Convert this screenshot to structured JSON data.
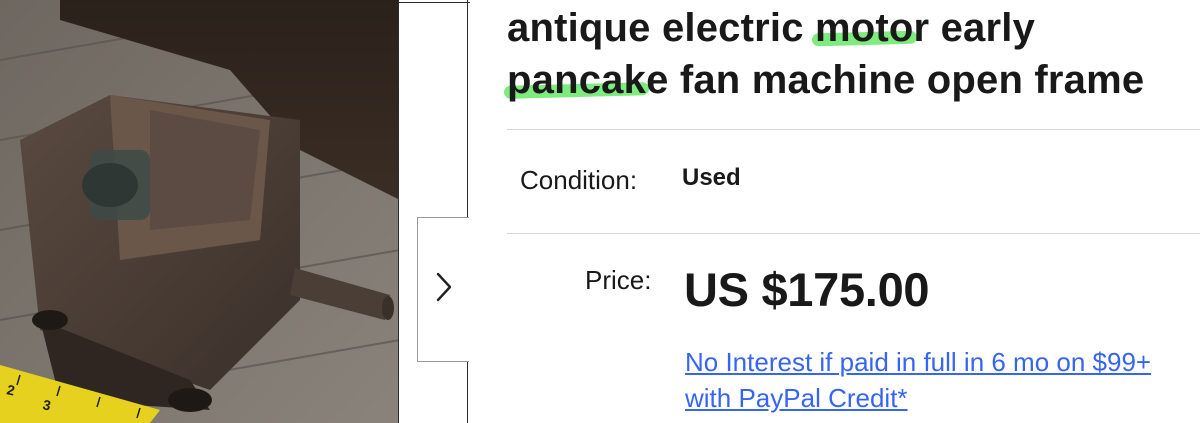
{
  "listing": {
    "title_line1_before": "antique electric ",
    "title_line1_highlight": "moto",
    "title_line1_after": "r early",
    "title_line2_highlight": "pancak",
    "title_line2_after": "e fan machine open frame",
    "condition_label": "Condition:",
    "condition_value": "Used",
    "price_label": "Price:",
    "price_value": "US $175.00",
    "credit_line1": "No Interest if paid in full in 6 mo on $99+",
    "credit_line2": "with PayPal Credit*"
  },
  "gallery": {
    "next_icon": "chevron-right-icon",
    "photo_subject": "rusty cast-iron electric motor on wooden floor with yellow tape measure"
  },
  "colors": {
    "highlight": "#66e866",
    "link": "#3665f3",
    "text": "#191919"
  }
}
